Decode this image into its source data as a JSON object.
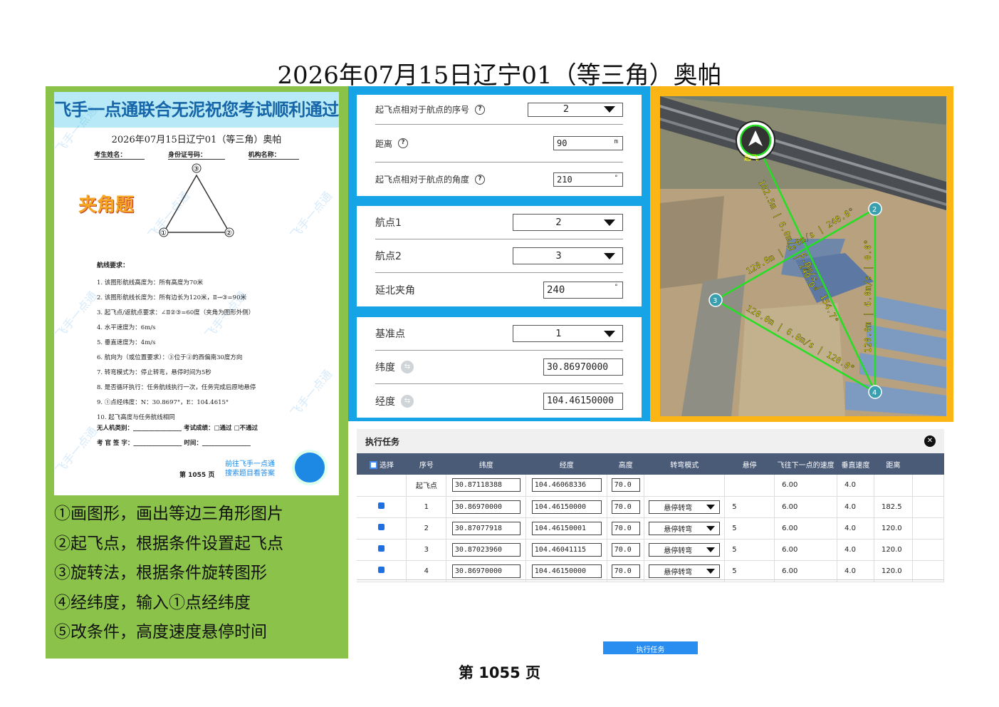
{
  "page_title": "2026年07月15日辽宁01（等三角）奥帕",
  "sheet": {
    "banner": "飞手一点通联合无泥祝您考试顺利通过",
    "title": "2026年07月15日辽宁01（等三角）奥帕",
    "fields": [
      "考生姓名：",
      "身份证号码：",
      "机构名称："
    ],
    "badge": "夹角题",
    "vertex_labels": [
      "③",
      "①",
      "②"
    ],
    "req_title": "航线要求：",
    "requirements": [
      "1.  该图形航线高度为：所有高度为70米",
      "2.  该图形航线长度为：所有边长为120米，Ⅱ→③=90米",
      "3.  起飞点/返航点要求：∠Ⅱ②③=60度（夹角为图形外侧）",
      "4.  水平速度为：6m/s",
      "5.  垂直速度为：4m/s",
      "6.  航向为（或位置要求）：③位于②的西偏南30度方向",
      "7.  转弯模式为：停止转弯，悬停时间为5秒",
      "8.  是否循环执行：任务航线执行一次，任务完成后原地悬停",
      "9.  ①点经纬度：N：30.8697°，E：104.4615°",
      "10. 起飞高度与任务航线相同"
    ],
    "sign_lines": [
      "无人机类别：________________  考试成绩：□通过  □不通过",
      "考 官 签 字：________________  时间：________________"
    ],
    "qr_text": [
      "前往飞手一点通",
      "搜索题目看答案"
    ],
    "page_no": "第  1055  页",
    "watermark": "飞手一点通"
  },
  "steps": [
    "①画图形，画出等边三角形图片",
    "②起飞点，根据条件设置起飞点",
    "③旋转法，根据条件旋转图形",
    "④经纬度，输入①点经纬度",
    "⑤改条件，高度速度悬停时间"
  ],
  "takeoff_card": {
    "seq_label": "起飞点相对于航点的序号",
    "seq_value": "2",
    "dist_label": "距离",
    "dist_value": "90",
    "dist_unit": "m",
    "angle_label": "起飞点相对于航点的角度",
    "angle_value": "210",
    "angle_unit": "°"
  },
  "waypoint_card": {
    "wp1_label": "航点1",
    "wp1_value": "2",
    "wp2_label": "航点2",
    "wp2_value": "3",
    "north_label": "延北夹角",
    "north_value": "240",
    "north_unit": "°"
  },
  "base_card": {
    "base_label": "基准点",
    "base_value": "1",
    "lat_label": "纬度",
    "lat_value": "30.86970000",
    "lon_label": "经度",
    "lon_value": "104.46150000"
  },
  "map": {
    "takeoff_label": "起飞",
    "points": [
      "2",
      "3",
      "4"
    ],
    "edge_labels": [
      "182.5m | 6.0m/s | 240.0°",
      "120.0m | 6.0m/s | 0.0°",
      "120.0m | 6.0m/s | 120.0°",
      "120.0m | 6.0m/s | 240.0°",
      "6.0m/s | 154.7°"
    ]
  },
  "task": {
    "title": "执行任务",
    "columns": [
      "选择",
      "序号",
      "纬度",
      "经度",
      "高度",
      "转弯模式",
      "悬停",
      "飞往下一点的速度",
      "垂直速度",
      "距离"
    ],
    "takeoff_row": {
      "seq": "起飞点",
      "lat": "30.87118388",
      "lon": "104.46068336",
      "alt": "70.0",
      "speed": "6.00",
      "vspeed": "4.0"
    },
    "rows": [
      {
        "seq": "1",
        "lat": "30.86970000",
        "lon": "104.46150000",
        "alt": "70.0",
        "turn": "悬停转弯",
        "hover": "5",
        "speed": "6.00",
        "vspeed": "4.0",
        "dist": "182.5"
      },
      {
        "seq": "2",
        "lat": "30.87077918",
        "lon": "104.46150001",
        "alt": "70.0",
        "turn": "悬停转弯",
        "hover": "5",
        "speed": "6.00",
        "vspeed": "4.0",
        "dist": "120.0"
      },
      {
        "seq": "3",
        "lat": "30.87023960",
        "lon": "104.46041115",
        "alt": "70.0",
        "turn": "悬停转弯",
        "hover": "5",
        "speed": "6.00",
        "vspeed": "4.0",
        "dist": "120.0"
      },
      {
        "seq": "4",
        "lat": "30.86970000",
        "lon": "104.46150000",
        "alt": "70.0",
        "turn": "悬停转弯",
        "hover": "5",
        "speed": "6.00",
        "vspeed": "4.0",
        "dist": "120.0"
      }
    ],
    "exec_button": "执行任务"
  },
  "footer": "第 1055 页"
}
